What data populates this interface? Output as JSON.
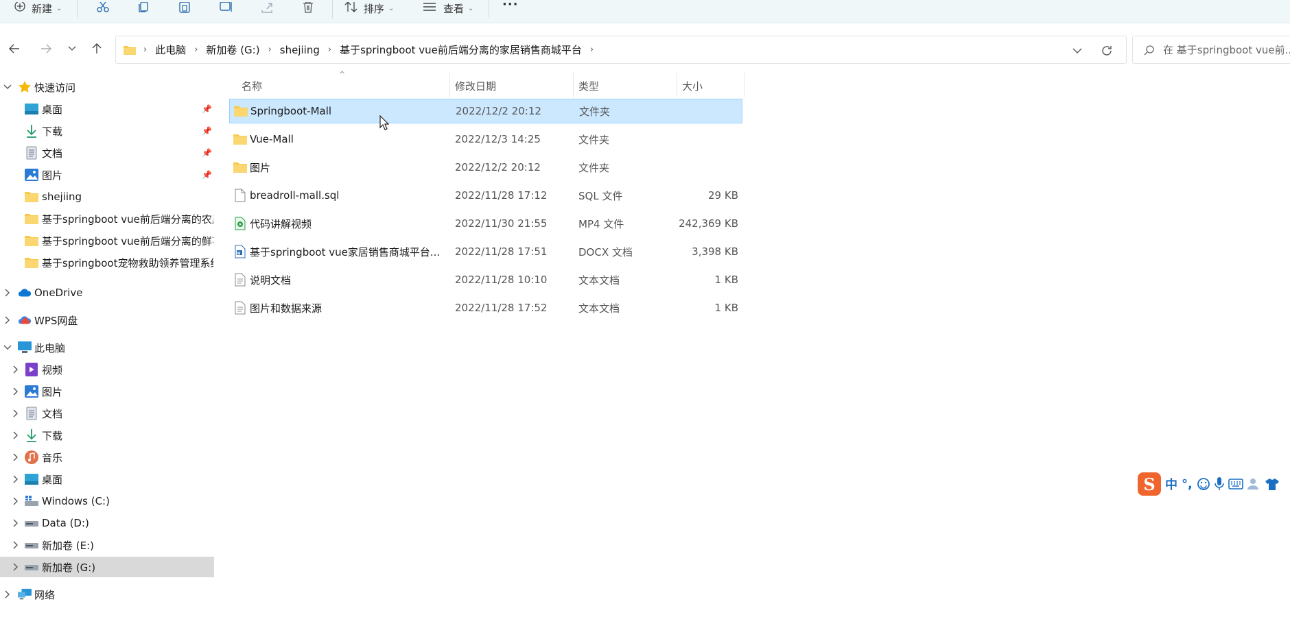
{
  "toolbar": {
    "new_label": "新建",
    "sort_label": "排序",
    "view_label": "查看",
    "more_label": "···"
  },
  "breadcrumb": [
    {
      "label": "此电脑"
    },
    {
      "label": "新加卷 (G:)"
    },
    {
      "label": "shejiing"
    },
    {
      "label": "基于springboot vue前后端分离的家居销售商城平台"
    }
  ],
  "search": {
    "placeholder": "在 基于springboot vue前..."
  },
  "sidebar": {
    "quick_access": {
      "label": "快速访问",
      "items": [
        {
          "label": "桌面",
          "icon": "desktop-icon",
          "pinned": true
        },
        {
          "label": "下载",
          "icon": "download-icon",
          "pinned": true
        },
        {
          "label": "文档",
          "icon": "document-icon",
          "pinned": true
        },
        {
          "label": "图片",
          "icon": "picture-icon",
          "pinned": true
        },
        {
          "label": "shejiing",
          "icon": "folder-icon",
          "pinned": false
        },
        {
          "label": "基于springboot vue前后端分离的农产",
          "icon": "folder-icon",
          "pinned": false
        },
        {
          "label": "基于springboot vue前后端分离的鲜花",
          "icon": "folder-icon",
          "pinned": false
        },
        {
          "label": "基于springboot宠物救助领养管理系统",
          "icon": "folder-icon",
          "pinned": false
        }
      ]
    },
    "onedrive": {
      "label": "OneDrive"
    },
    "wps": {
      "label": "WPS网盘"
    },
    "this_pc": {
      "label": "此电脑",
      "items": [
        {
          "label": "视频",
          "icon": "video-icon"
        },
        {
          "label": "图片",
          "icon": "picture-icon"
        },
        {
          "label": "文档",
          "icon": "document-icon"
        },
        {
          "label": "下载",
          "icon": "download-icon"
        },
        {
          "label": "音乐",
          "icon": "music-icon"
        },
        {
          "label": "桌面",
          "icon": "desktop-icon"
        },
        {
          "label": "Windows (C:)",
          "icon": "windows-drive-icon"
        },
        {
          "label": "Data (D:)",
          "icon": "drive-icon"
        },
        {
          "label": "新加卷 (E:)",
          "icon": "drive-icon"
        },
        {
          "label": "新加卷 (G:)",
          "icon": "drive-icon",
          "selected": true
        }
      ]
    },
    "network": {
      "label": "网络"
    }
  },
  "columns": {
    "name": "名称",
    "date": "修改日期",
    "type": "类型",
    "size": "大小"
  },
  "files": [
    {
      "name": "Springboot-Mall",
      "date": "2022/12/2 20:12",
      "type": "文件夹",
      "size": "",
      "icon": "folder-icon",
      "selected": true
    },
    {
      "name": "Vue-Mall",
      "date": "2022/12/3 14:25",
      "type": "文件夹",
      "size": "",
      "icon": "folder-icon"
    },
    {
      "name": "图片",
      "date": "2022/12/2 20:12",
      "type": "文件夹",
      "size": "",
      "icon": "folder-icon"
    },
    {
      "name": "breadroll-mall.sql",
      "date": "2022/11/28 17:12",
      "type": "SQL 文件",
      "size": "29 KB",
      "icon": "file-icon"
    },
    {
      "name": "代码讲解视频",
      "date": "2022/11/30 21:55",
      "type": "MP4 文件",
      "size": "242,369 KB",
      "icon": "video-file-icon"
    },
    {
      "name": "基于springboot vue家居销售商城平台...",
      "date": "2022/11/28 17:51",
      "type": "DOCX 文档",
      "size": "3,398 KB",
      "icon": "docx-file-icon"
    },
    {
      "name": "说明文档",
      "date": "2022/11/28 10:10",
      "type": "文本文档",
      "size": "1 KB",
      "icon": "text-file-icon"
    },
    {
      "name": "图片和数据来源",
      "date": "2022/11/28 17:52",
      "type": "文本文档",
      "size": "1 KB",
      "icon": "text-file-icon"
    }
  ],
  "ime": {
    "logo": "S",
    "mode": "中",
    "punct": "°,"
  },
  "colors": {
    "selection_bg": "#cce8ff",
    "selection_border": "#99d1ff",
    "folder_yellow": "#f8c94a",
    "accent_blue": "#1a6fc4",
    "ime_orange": "#f0642d"
  }
}
